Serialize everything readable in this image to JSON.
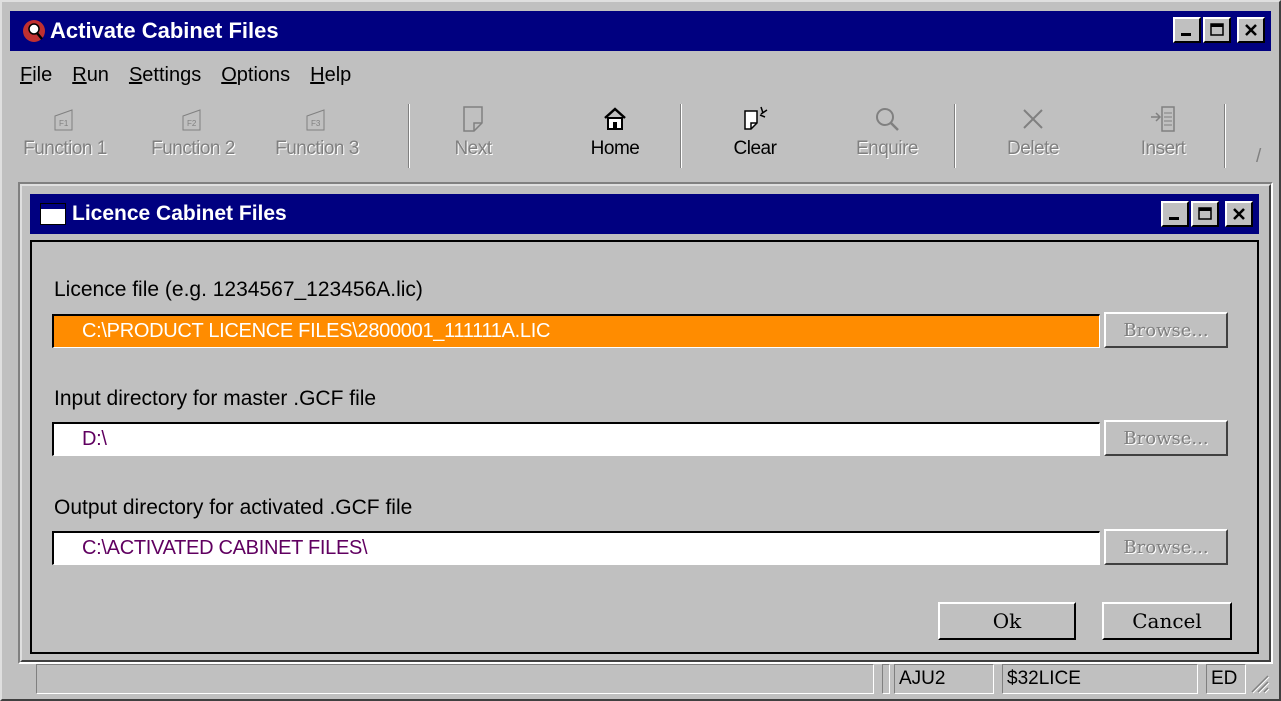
{
  "window": {
    "title": "Activate Cabinet Files"
  },
  "menu": [
    {
      "label": "File",
      "mnemonic": "F",
      "rest": "ile"
    },
    {
      "label": "Run",
      "mnemonic": "R",
      "rest": "un"
    },
    {
      "label": "Settings",
      "mnemonic": "S",
      "rest": "ettings"
    },
    {
      "label": "Options",
      "mnemonic": "O",
      "rest": "ptions"
    },
    {
      "label": "Help",
      "mnemonic": "H",
      "rest": "elp"
    }
  ],
  "toolbar": {
    "function1": {
      "label": "Function 1",
      "icon": "f1-key-icon",
      "enabled": false
    },
    "function2": {
      "label": "Function 2",
      "icon": "f2-key-icon",
      "enabled": false
    },
    "function3": {
      "label": "Function 3",
      "icon": "f3-key-icon",
      "enabled": false
    },
    "next": {
      "label": "Next",
      "icon": "page-icon",
      "enabled": false
    },
    "home": {
      "label": "Home",
      "icon": "house-icon",
      "enabled": true
    },
    "clear": {
      "label": "Clear",
      "icon": "clear-sparkle-icon",
      "enabled": true
    },
    "enquire": {
      "label": "Enquire",
      "icon": "magnifier-icon",
      "enabled": false
    },
    "delete": {
      "label": "Delete",
      "icon": "x-icon",
      "enabled": false
    },
    "insert": {
      "label": "Insert",
      "icon": "insert-icon",
      "enabled": false
    }
  },
  "dialog": {
    "title": "Licence Cabinet Files",
    "licence_label": "Licence file (e.g. 1234567_123456A.lic)",
    "licence_value": "C:\\PRODUCT LICENCE FILES\\2800001_111111A.LIC",
    "input_label": "Input directory for master .GCF file",
    "input_value": "D:\\",
    "output_label": "Output directory for activated .GCF file",
    "output_value": "C:\\ACTIVATED CABINET FILES\\",
    "browse_label": "Browse...",
    "ok_label": "Ok",
    "cancel_label": "Cancel"
  },
  "statusbar": {
    "pane1": "",
    "pane2": "AJU2",
    "pane3": "$32LICE",
    "pane4": "ED"
  },
  "colors": {
    "title_bar": "#000080",
    "highlight_field": "#ff8c00",
    "field_text": "#600060",
    "face": "#c0c0c0"
  }
}
